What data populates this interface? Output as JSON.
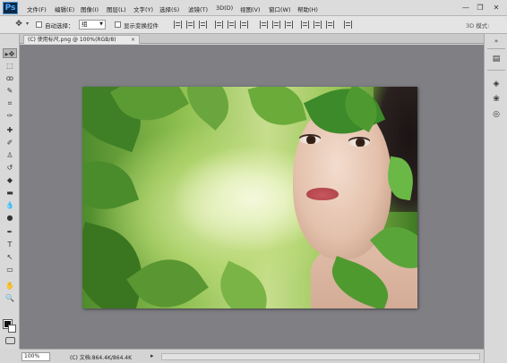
{
  "app": {
    "logo": "Ps"
  },
  "menu": [
    "文件(F)",
    "编辑(E)",
    "图像(I)",
    "图层(L)",
    "文字(Y)",
    "选择(S)",
    "滤镜(T)",
    "3D(D)",
    "视图(V)",
    "窗口(W)",
    "帮助(H)"
  ],
  "window_controls": {
    "minimize": "—",
    "restore": "❐",
    "close": "✕"
  },
  "options": {
    "move_tool_icon": "move-icon",
    "auto_select_label": "自动选择：",
    "auto_select_value": "组",
    "show_transform_label": "显示变换控件",
    "mode_3d_label": "3D 模式:"
  },
  "document": {
    "tab_title": "(C) 使用标尺.png @ 100%(RGB/8)",
    "close_glyph": "×"
  },
  "status": {
    "zoom": "100%",
    "doc_info": "(C) 文档:864.4K/864.4K",
    "arrow": "▸"
  },
  "tools": [
    "move-icon",
    "marquee-icon",
    "lasso-icon",
    "quick-select-icon",
    "crop-icon",
    "eyedropper-icon",
    "healing-brush-icon",
    "brush-icon",
    "clone-stamp-icon",
    "history-brush-icon",
    "eraser-icon",
    "gradient-icon",
    "blur-icon",
    "dodge-icon",
    "pen-icon",
    "type-icon",
    "path-select-icon",
    "rectangle-icon",
    "hand-icon",
    "zoom-icon"
  ],
  "tool_glyphs": [
    "▸✥",
    "⬚",
    "ꝏ",
    "✎",
    "⌗",
    "✑",
    "✚",
    "✐",
    "♙",
    "↺",
    "◆",
    "▬",
    "💧",
    "●",
    "✒",
    "T",
    "↖",
    "▭",
    "✋",
    "🔍"
  ],
  "dock_glyphs": {
    "expand": "»",
    "history": "▤",
    "layers": "◈",
    "channels": "❀",
    "paths": "◎"
  },
  "colors": {
    "workspace": "#7f7f84",
    "chrome": "#d9d9d9",
    "accent": "#0b2a48"
  }
}
